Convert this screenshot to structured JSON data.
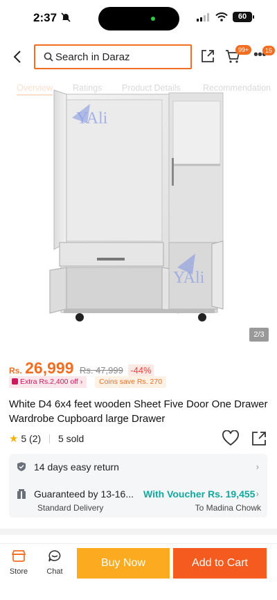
{
  "status_bar": {
    "time": "2:37",
    "battery": "60"
  },
  "header": {
    "search_placeholder": "Search in Daraz",
    "cart_badge": "99+",
    "more_badge": "15"
  },
  "tabs": [
    {
      "label": "Overview"
    },
    {
      "label": "Ratings"
    },
    {
      "label": "Product Details"
    },
    {
      "label": "Recommendation"
    }
  ],
  "gallery": {
    "counter": "2/3",
    "watermark": "YAli"
  },
  "product": {
    "currency": "Rs.",
    "price": "26,999",
    "original_price": "Rs. 47,999",
    "discount": "-44%",
    "extra_off": "Extra Rs.2,400 off",
    "coins_save": "Coins save Rs. 270",
    "title": "White D4 6x4 feet wooden Sheet Five Door One Drawer Wardrobe Cupboard large Drawer",
    "rating": "5",
    "rating_count": "(2)",
    "sold": "5 sold"
  },
  "delivery": {
    "return_policy": "14 days easy return",
    "guarantee": "Guaranteed by 13-16...",
    "voucher": "With Voucher Rs. 19,455",
    "delivery_type": "Standard Delivery",
    "destination": "To Madina Chowk"
  },
  "bottom_bar": {
    "store_label": "Store",
    "chat_label": "Chat",
    "buy_now": "Buy Now",
    "add_to_cart": "Add to Cart"
  },
  "colors": {
    "accent": "#f36d21",
    "buy_now": "#fcab20",
    "add_to_cart": "#f55b1e",
    "voucher": "#12a89d"
  }
}
